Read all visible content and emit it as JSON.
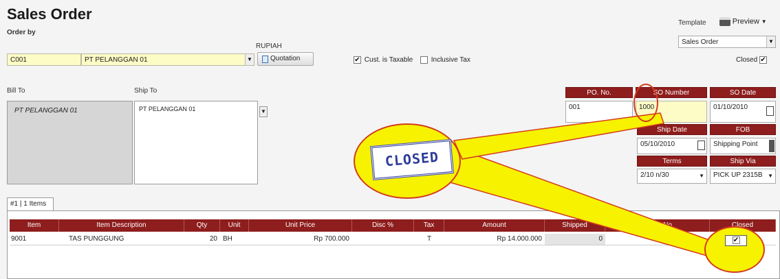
{
  "header": {
    "title": "Sales Order",
    "order_by_label": "Order by",
    "currency_label": "RUPIAH",
    "template_label": "Template",
    "preview_label": "Preview",
    "template_value": "Sales Order",
    "closed_label": "Closed"
  },
  "customer": {
    "code": "C001",
    "name": "PT PELANGGAN 01",
    "quotation_label": "Quotation",
    "taxable_label": "Cust. is Taxable",
    "taxable_checked": true,
    "inclusive_label": "Inclusive Tax",
    "inclusive_checked": false
  },
  "address": {
    "bill_to_label": "Bill To",
    "ship_to_label": "Ship To",
    "bill_to": "PT PELANGGAN 01",
    "ship_to": "PT PELANGGAN 01"
  },
  "order_info": {
    "po_no_label": "PO. No.",
    "po_no": "001",
    "so_number_label": "SO Number",
    "so_number": "1000",
    "so_date_label": "SO Date",
    "so_date": "01/10/2010",
    "ship_date_label": "Ship Date",
    "ship_date": "05/10/2010",
    "fob_label": "FOB",
    "fob": "Shipping Point",
    "terms_label": "Terms",
    "terms": "2/10 n/30",
    "ship_via_label": "Ship Via",
    "ship_via": "PICK UP 2315B"
  },
  "stamp": {
    "text": "CLOSED"
  },
  "items_tab": {
    "label": "#1 | 1 Items"
  },
  "table": {
    "columns": [
      "Item",
      "Item Description",
      "Qty",
      "Unit",
      "Unit Price",
      "Disc %",
      "Tax",
      "Amount",
      "Shipped",
      "Quote No",
      "Closed"
    ],
    "rows": [
      {
        "item": "9001",
        "description": "TAS PUNGGUNG",
        "qty": "20",
        "unit": "BH",
        "unit_price": "Rp 700.000",
        "disc": "",
        "tax": "T",
        "amount": "Rp 14.000.000",
        "shipped": "0",
        "quote_no": "",
        "closed": true
      }
    ]
  },
  "colors": {
    "header_maroon": "#8e1d1d",
    "field_yellow": "#fdfbc6",
    "callout_yellow": "#f7f200",
    "callout_outline": "#d43b1e",
    "stamp_blue": "#2d3b9c"
  }
}
